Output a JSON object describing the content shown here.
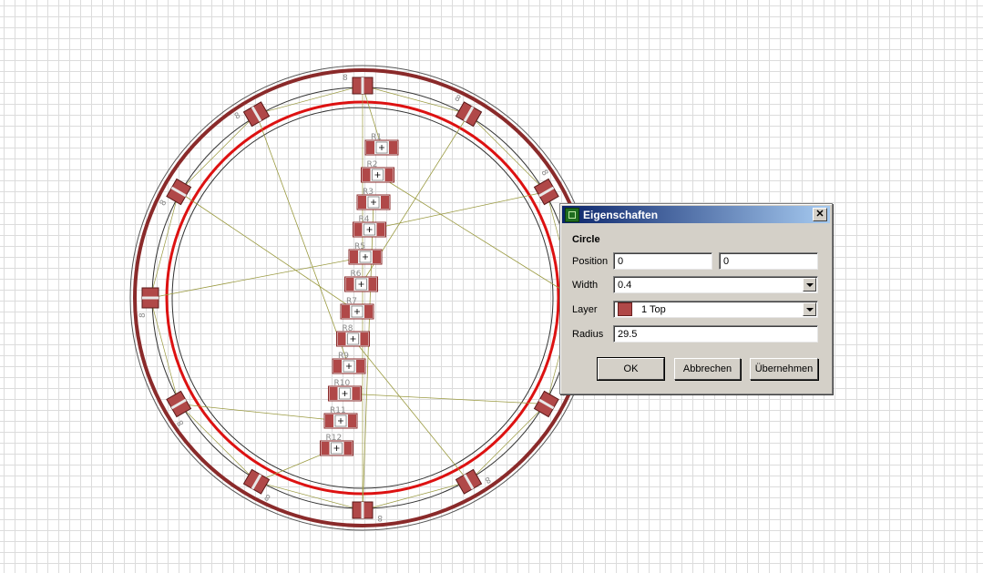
{
  "window": {
    "title": "Eigenschaften",
    "icon": "pcb-icon",
    "close": "close-icon"
  },
  "dialog": {
    "section": "Circle",
    "position_label": "Position",
    "position_x": "0",
    "position_y": "0",
    "width_label": "Width",
    "width_value": "0.4",
    "layer_label": "Layer",
    "layer_value": "1 Top",
    "layer_color": "#b04848",
    "radius_label": "Radius",
    "radius_value": "29.5",
    "ok": "OK",
    "cancel": "Abbrechen",
    "apply": "Übernehmen"
  },
  "board": {
    "components": [
      "R1",
      "R2",
      "R3",
      "R4",
      "R5",
      "R6",
      "R7",
      "R8",
      "R9",
      "R10",
      "R11",
      "R12"
    ],
    "led_labels": [
      "8",
      "8",
      "8",
      "8",
      "8",
      "8",
      "8",
      "8",
      "8",
      "8",
      "8",
      "8"
    ],
    "colors": {
      "ring": "#dd1111",
      "outline": "#8a2a2a",
      "rat": "#9a9a40"
    }
  }
}
